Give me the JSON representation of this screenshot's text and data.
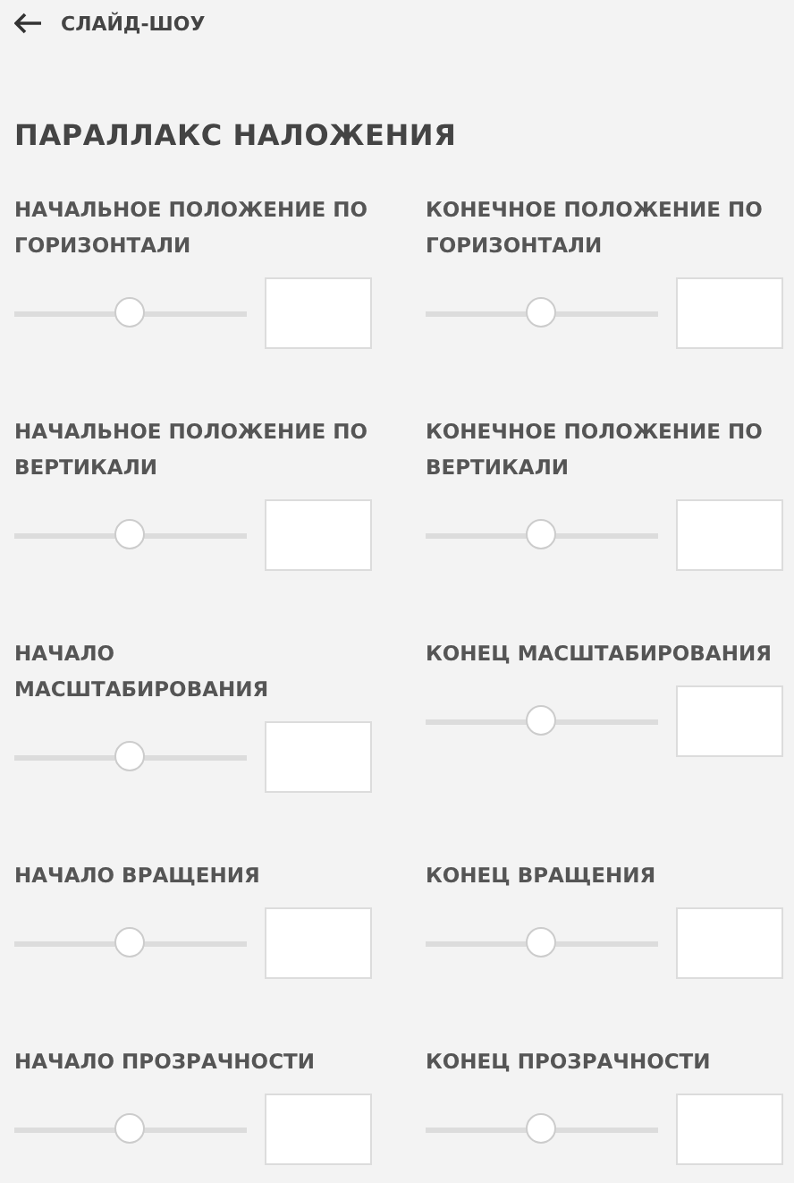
{
  "header": {
    "title": "СЛАЙД-ШОУ"
  },
  "section_title": "ПАРАЛЛАКС НАЛОЖЕНИЯ",
  "settings": [
    {
      "label": "НАЧАЛЬНОЕ ПОЛОЖЕНИЕ ПО\nГОРИЗОНТАЛИ",
      "level": 0.5
    },
    {
      "label": "КОНЕЧНОЕ ПОЛОЖЕНИЕ ПО\nГОРИЗОНТАЛИ",
      "level": 0.5
    },
    {
      "label": "НАЧАЛЬНОЕ ПОЛОЖЕНИЕ ПО\nВЕРТИКАЛИ",
      "level": 0.5
    },
    {
      "label": "КОНЕЧНОЕ ПОЛОЖЕНИЕ ПО\nВЕРТИКАЛИ",
      "level": 0.5
    },
    {
      "label": "НАЧАЛО\nМАСШТАБИРОВАНИЯ",
      "level": 0.5
    },
    {
      "label": "КОНЕЦ МАСШТАБИРОВАНИЯ",
      "level": 0.5
    },
    {
      "label": "НАЧАЛО ВРАЩЕНИЯ",
      "level": 0.5
    },
    {
      "label": "КОНЕЦ ВРАЩЕНИЯ",
      "level": 0.5
    },
    {
      "label": "НАЧАЛО ПРОЗРАЧНОСТИ",
      "level": 0.5
    },
    {
      "label": "КОНЕЦ ПРОЗРАЧНОСТИ",
      "level": 0.5
    }
  ]
}
